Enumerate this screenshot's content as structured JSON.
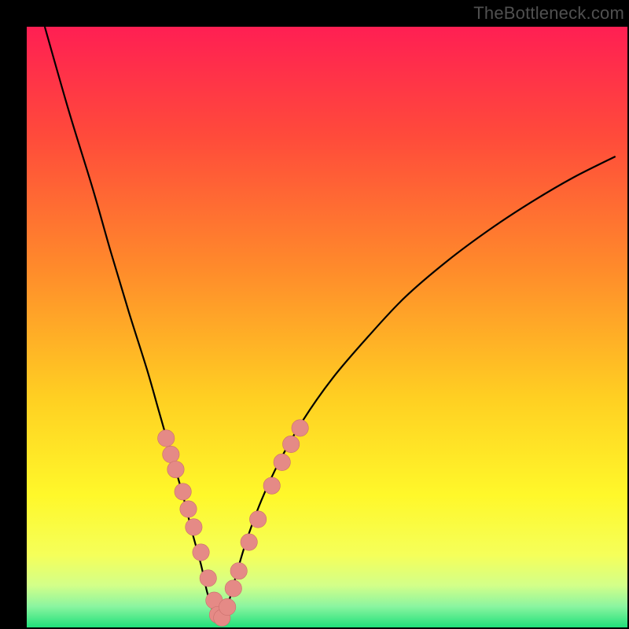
{
  "watermark": "TheBottleneck.com",
  "colors": {
    "frame": "#000000",
    "gradient_stops": [
      {
        "offset": 0.0,
        "color": "#ff1f53"
      },
      {
        "offset": 0.18,
        "color": "#ff4a3b"
      },
      {
        "offset": 0.4,
        "color": "#ff8a2b"
      },
      {
        "offset": 0.62,
        "color": "#ffd022"
      },
      {
        "offset": 0.78,
        "color": "#fff82a"
      },
      {
        "offset": 0.88,
        "color": "#f5ff5a"
      },
      {
        "offset": 0.93,
        "color": "#d3ff89"
      },
      {
        "offset": 0.965,
        "color": "#8bf5a0"
      },
      {
        "offset": 1.0,
        "color": "#20e07a"
      }
    ],
    "curve": "#000000",
    "marker_fill": "#e58a86",
    "marker_stroke": "#c96f6b"
  },
  "chart_data": {
    "type": "line",
    "title": "",
    "xlabel": "",
    "ylabel": "",
    "xlim": [
      0,
      100
    ],
    "ylim": [
      0,
      100
    ],
    "grid": false,
    "series": [
      {
        "name": "bottleneck-curve",
        "x": [
          3,
          7,
          11,
          14,
          17,
          20,
          22,
          24,
          26,
          27.5,
          29,
          30,
          31,
          31.7,
          32.3,
          33,
          34,
          35,
          36.6,
          39,
          42,
          46,
          51,
          57,
          63,
          70,
          77,
          84,
          91,
          98
        ],
        "values": [
          100,
          86,
          73,
          62.5,
          52.5,
          43,
          36,
          29,
          22,
          16,
          10.5,
          6,
          2.7,
          0.9,
          0.7,
          2.3,
          5.5,
          9.2,
          14.5,
          21,
          27.5,
          34.5,
          41.6,
          48.6,
          55,
          61,
          66.2,
          70.8,
          74.9,
          78.4
        ]
      }
    ],
    "markers": {
      "name": "highlighted-points",
      "x": [
        23.2,
        24.0,
        24.8,
        26.0,
        26.9,
        27.8,
        29.0,
        30.2,
        31.2,
        31.8,
        32.5,
        33.4,
        34.4,
        35.3,
        37.0,
        38.5,
        40.8,
        42.5,
        44.0,
        45.5
      ],
      "values": [
        31.5,
        28.8,
        26.3,
        22.6,
        19.7,
        16.7,
        12.5,
        8.2,
        4.5,
        2.1,
        1.6,
        3.4,
        6.5,
        9.4,
        14.2,
        18.0,
        23.6,
        27.5,
        30.5,
        33.2
      ]
    },
    "marker_radius_frac": 0.014
  }
}
